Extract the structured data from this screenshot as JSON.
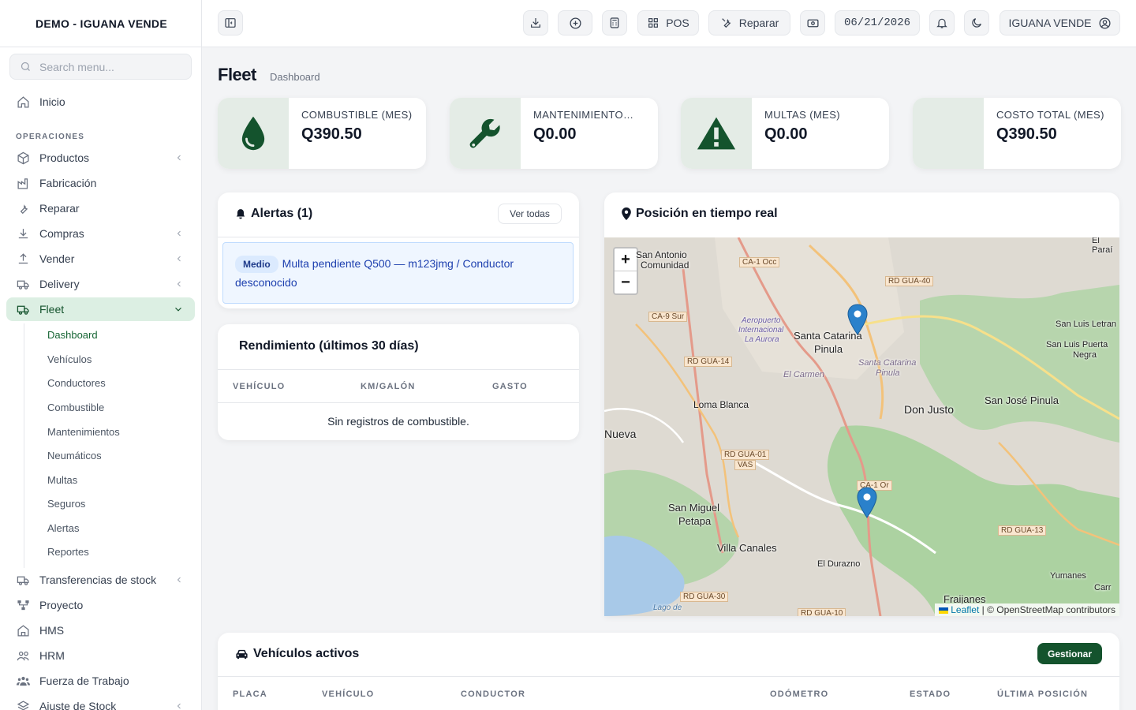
{
  "sidebar": {
    "brand": "DEMO - IGUANA VENDE",
    "search_placeholder": "Search menu...",
    "home": "Inicio",
    "section": "OPERACIONES",
    "items": [
      {
        "label": "Productos"
      },
      {
        "label": "Fabricación"
      },
      {
        "label": "Reparar"
      },
      {
        "label": "Compras"
      },
      {
        "label": "Vender"
      },
      {
        "label": "Delivery"
      },
      {
        "label": "Fleet"
      },
      {
        "label": "Transferencias de stock"
      },
      {
        "label": "Proyecto"
      },
      {
        "label": "HMS"
      },
      {
        "label": "HRM"
      },
      {
        "label": "Fuerza de Trabajo"
      },
      {
        "label": "Ajuste de Stock"
      }
    ],
    "fleet_sub": [
      "Dashboard",
      "Vehículos",
      "Conductores",
      "Combustible",
      "Mantenimientos",
      "Neumáticos",
      "Multas",
      "Seguros",
      "Alertas",
      "Reportes"
    ]
  },
  "topbar": {
    "pos": "POS",
    "repair": "Reparar",
    "date": "06/21/2026",
    "user": "IGUANA VENDE"
  },
  "page": {
    "title": "Fleet",
    "subtitle": "Dashboard"
  },
  "stats": [
    {
      "label": "COMBUSTIBLE (MES)",
      "value": "Q390.50",
      "icon": "drop-icon"
    },
    {
      "label": "MANTENIMIENTO (MES)",
      "value": "Q0.00",
      "icon": "wrench-icon"
    },
    {
      "label": "MULTAS (MES)",
      "value": "Q0.00",
      "icon": "warning-icon"
    },
    {
      "label": "COSTO TOTAL (MES)",
      "value": "Q390.50",
      "icon": "money-icon"
    }
  ],
  "alerts": {
    "title": "Alertas (1)",
    "view_all": "Ver todas",
    "items": [
      {
        "level": "Medio",
        "text": "Multa pendiente Q500 — m123jmg / Conductor desconocido"
      }
    ]
  },
  "performance": {
    "title": "Rendimiento (últimos 30 días)",
    "headers": [
      "VEHÍCULO",
      "KM/GALÓN",
      "GASTO"
    ],
    "empty": "Sin registros de combustible."
  },
  "map": {
    "title": "Posición en tiempo real",
    "zoom_in": "+",
    "zoom_out": "−",
    "attribution_link": "Leaflet",
    "attribution_text": "| © OpenStreetMap contributors",
    "places": [
      "San Antonio",
      "Comunidad",
      "Santa Catarina",
      "Pinula",
      "Santa Catarina",
      "Pinula",
      "Don Justo",
      "San José Pinula",
      "San Luis Letran",
      "San Luis Puerta",
      "Negra",
      "Loma Blanca",
      "San Miguel",
      "Petapa",
      "Villa Canales",
      "El Durazno",
      "El Carmen",
      "Yumanes",
      "Fraijanes",
      "Aeropuerto",
      "Internacional",
      "La Aurora",
      "El Paraí",
      "Nueva",
      "Carr",
      "Lago de"
    ],
    "roads": [
      "CA-1 Occ",
      "RD GUA-40",
      "CA-9 Sur",
      "RD GUA-14",
      "RD GUA-01",
      "VAS",
      "CA-1 Or",
      "RD GUA-13",
      "RD GUA-30",
      "RD GUA-10"
    ]
  },
  "vehicles": {
    "title": "Vehículos activos",
    "manage": "Gestionar",
    "headers": [
      "PLACA",
      "VEHÍCULO",
      "CONDUCTOR",
      "ODÓMETRO",
      "ESTADO",
      "ÚLTIMA POSICIÓN"
    ]
  }
}
